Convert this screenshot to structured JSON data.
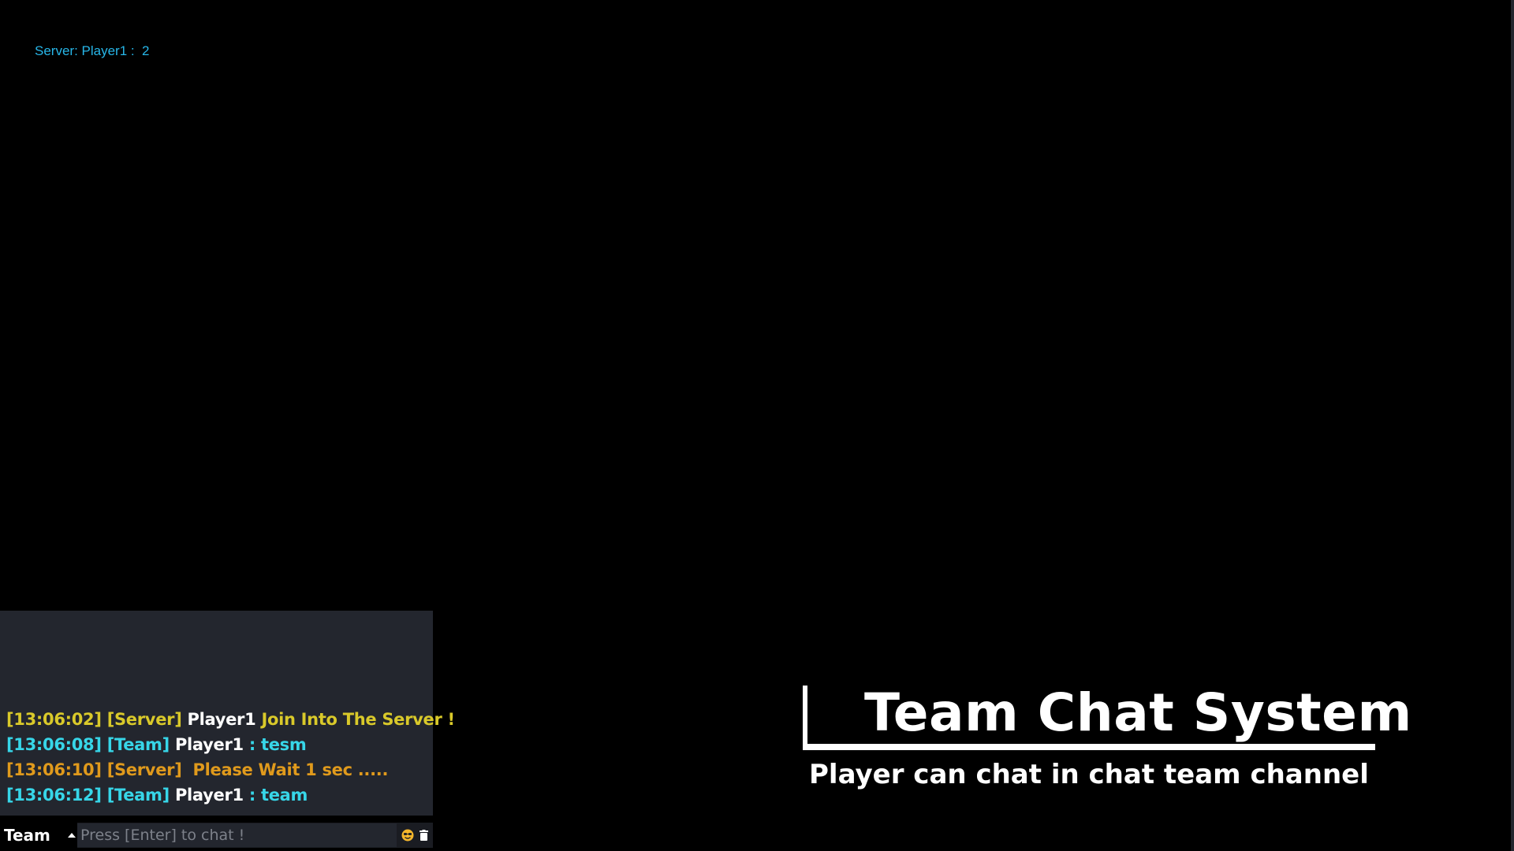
{
  "debug": {
    "server_text": "Server: Player1 :  2"
  },
  "chat": {
    "messages": [
      {
        "time": "[13:06:02]",
        "channel": "[Server]",
        "player": "Player1",
        "text": "Join Into The Server !",
        "kind": "server"
      },
      {
        "time": "[13:06:08]",
        "channel": "[Team]",
        "player": "Player1",
        "text": ": tesm",
        "kind": "team"
      },
      {
        "time": "[13:06:10]",
        "channel": "[Server]",
        "player": "",
        "text": "Please Wait 1 sec .....",
        "kind": "warn"
      },
      {
        "time": "[13:06:12]",
        "channel": "[Team]",
        "player": "Player1",
        "text": ": team",
        "kind": "team"
      }
    ],
    "channel_selected": "Team",
    "input_placeholder": "Press [Enter] to chat !",
    "input_value": ""
  },
  "overlay": {
    "title": "Team Chat System",
    "subtitle": "Player can chat in chat team channel"
  },
  "colors": {
    "background": "#000000",
    "panel": "#23262e",
    "server_message": "#d9c92a",
    "team_message": "#37d6e8",
    "warning_message": "#e09a1c",
    "debug_text": "#27b6e8"
  },
  "icons": {
    "channel_caret": "caret-up-icon",
    "emoji": "emoji-icon",
    "clear": "trash-icon"
  }
}
